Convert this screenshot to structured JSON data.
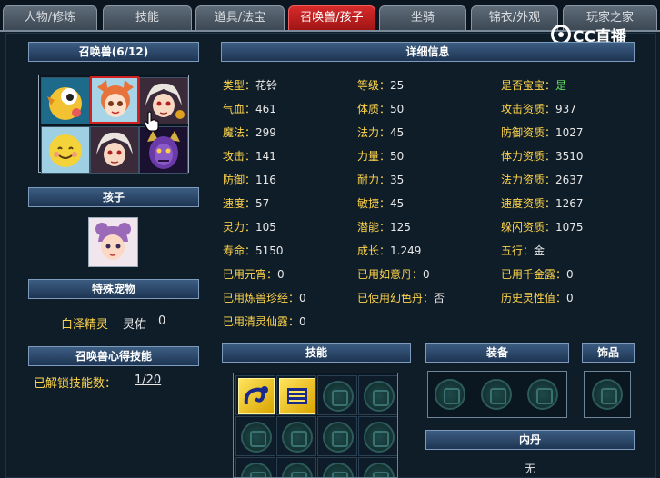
{
  "tabs": [
    {
      "label": "人物/修炼",
      "active": false
    },
    {
      "label": "技能",
      "active": false
    },
    {
      "label": "道具/法宝",
      "active": false
    },
    {
      "label": "召唤兽/孩子",
      "active": true
    },
    {
      "label": "坐骑",
      "active": false
    },
    {
      "label": "锦衣/外观",
      "active": false
    },
    {
      "label": "玩家之家",
      "active": false
    }
  ],
  "watermark": "CC直播",
  "summons": {
    "header": "召唤兽(6/12)",
    "selected_index": 1,
    "slots": [
      {
        "icon": "yellow-bird-pet-icon",
        "color": "#f2c232"
      },
      {
        "icon": "fox-girl-pet-icon",
        "color": "#e8733a"
      },
      {
        "icon": "white-hair-warrior-pet-icon",
        "color": "#d9d0c8"
      },
      {
        "icon": "smiley-face-pet-icon",
        "color": "#f4d33a"
      },
      {
        "icon": "white-hair-warrior-pet-icon",
        "color": "#d9d0c8"
      },
      {
        "icon": "purple-demon-pet-icon",
        "color": "#6a3aa8"
      }
    ]
  },
  "child": {
    "header": "孩子",
    "icon": "child-portrait-icon"
  },
  "special_pet": {
    "header": "特殊宠物",
    "name": "白泽精灵",
    "attr_label": "灵佑",
    "attr_value": "0"
  },
  "skill_learn": {
    "header": "召唤兽心得技能",
    "unlocked_label": "已解锁技能数：",
    "unlocked_value": "1/20"
  },
  "details": {
    "header": "详细信息",
    "col1": [
      {
        "k": "类型：",
        "v": "花铃"
      },
      {
        "k": "气血：",
        "v": "461"
      },
      {
        "k": "魔法：",
        "v": "299"
      },
      {
        "k": "攻击：",
        "v": "141"
      },
      {
        "k": "防御：",
        "v": "116"
      },
      {
        "k": "速度：",
        "v": "57"
      },
      {
        "k": "灵力：",
        "v": "105"
      },
      {
        "k": "寿命：",
        "v": "5150"
      },
      {
        "k": "已用元宵：",
        "v": "0"
      },
      {
        "k": "已用炼兽珍经：",
        "v": "0"
      },
      {
        "k": "已用清灵仙露：",
        "v": "0"
      }
    ],
    "col2": [
      {
        "k": "等级：",
        "v": "25"
      },
      {
        "k": "体质：",
        "v": "50"
      },
      {
        "k": "法力：",
        "v": "45"
      },
      {
        "k": "力量：",
        "v": "50"
      },
      {
        "k": "耐力：",
        "v": "35"
      },
      {
        "k": "敏捷：",
        "v": "45"
      },
      {
        "k": "潜能：",
        "v": "125"
      },
      {
        "k": "成长：",
        "v": "1.249"
      },
      {
        "k": "已用如意丹：",
        "v": "0"
      },
      {
        "k": "已使用幻色丹：",
        "v": "否"
      }
    ],
    "col3": [
      {
        "k": "是否宝宝：",
        "v": "是"
      },
      {
        "k": "攻击资质：",
        "v": "937"
      },
      {
        "k": "防御资质：",
        "v": "1027"
      },
      {
        "k": "体力资质：",
        "v": "3510"
      },
      {
        "k": "法力资质：",
        "v": "2637"
      },
      {
        "k": "速度资质：",
        "v": "1267"
      },
      {
        "k": "躲闪资质：",
        "v": "1075"
      },
      {
        "k": "五行：",
        "v": "金"
      },
      {
        "k": "已用千金露：",
        "v": "0"
      },
      {
        "k": "历史灵性值：",
        "v": "0"
      }
    ]
  },
  "skills": {
    "header": "技能",
    "slots": [
      {
        "icon": "water-dragon-skill-icon",
        "filled": true
      },
      {
        "icon": "book-skill-icon",
        "filled": true
      },
      {
        "icon": "empty-skill-slot-icon",
        "filled": false
      },
      {
        "icon": "empty-skill-slot-icon",
        "filled": false
      },
      {
        "icon": "empty-skill-slot-icon",
        "filled": false
      },
      {
        "icon": "empty-skill-slot-icon",
        "filled": false
      },
      {
        "icon": "empty-skill-slot-icon",
        "filled": false
      },
      {
        "icon": "empty-skill-slot-icon",
        "filled": false
      },
      {
        "icon": "empty-skill-slot-icon",
        "filled": false
      },
      {
        "icon": "empty-skill-slot-icon",
        "filled": false
      },
      {
        "icon": "empty-skill-slot-icon",
        "filled": false
      },
      {
        "icon": "empty-skill-slot-icon",
        "filled": false
      }
    ]
  },
  "equipment": {
    "header": "装备"
  },
  "ornament": {
    "header": "饰品"
  },
  "inner_dan": {
    "header": "内丹",
    "value": "无"
  },
  "colors": {
    "accent_yellow": "#ffd54a",
    "value_white": "#e8e8e8",
    "yes_green": "#63e063",
    "active_tab": "#c41e1e"
  }
}
